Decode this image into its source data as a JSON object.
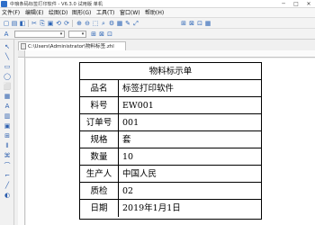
{
  "window": {
    "title": "中琅条码标签打印软件 - V6.3.0 试用版 单机",
    "min": "─",
    "max": "□",
    "close": "✕"
  },
  "menu": [
    "文件(F)",
    "编辑(E)",
    "绘图(D)",
    "图形(G)",
    "工具(T)",
    "窗口(W)",
    "帮助(H)"
  ],
  "toolbar": {
    "font_value": "",
    "size_value": ""
  },
  "document": {
    "tab_path": "C:\\Users\\Administrator\\物料标签.zhl"
  },
  "label": {
    "title": "物料标示单",
    "rows": [
      {
        "label": "品名",
        "value": "标签打印软件"
      },
      {
        "label": "料号",
        "value": "EW001"
      },
      {
        "label": "订单号",
        "value": "001"
      },
      {
        "label": "规格",
        "value": "套"
      },
      {
        "label": "数量",
        "value": "10"
      },
      {
        "label": "生产人",
        "value": "中国人民"
      },
      {
        "label": "质检",
        "value": "02"
      },
      {
        "label": "日期",
        "value": "2019年1月1日"
      }
    ]
  },
  "icons": {
    "app": "app-logo-icon",
    "tool_glyphs": [
      "▢",
      "▤",
      "◧",
      "✂",
      "⎘",
      "▣",
      "⟲",
      "⟳",
      "⊕",
      "⊖",
      "⬚",
      "⌕",
      "⚙",
      "▦",
      "✎",
      "⤢",
      "⊞",
      "⊠",
      "⊡"
    ],
    "side_glyphs": [
      "↖",
      "╲",
      "▭",
      "◯",
      "⬜",
      "▦",
      "A",
      "▥",
      "▣",
      "⊞",
      "⫴",
      "⌘",
      "⌒",
      "⌐",
      "╱",
      "◐"
    ]
  },
  "colors": {
    "toolbar_icon": "#2a63b5",
    "side_icon": "#2d5fae"
  }
}
